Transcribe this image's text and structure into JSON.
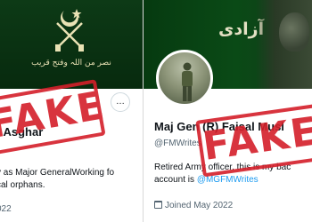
{
  "left_profile": {
    "banner_caption": "نصر من اللہ وفتح قریب",
    "more_button": "…",
    "name": ") Asghar",
    "bio_line1": "y as Major GeneralWorking fo",
    "bio_line2": "cal orphans.",
    "joined": "022",
    "stamp": "FAKE"
  },
  "right_profile": {
    "banner_title": "آزادی",
    "name": "Maj Gen (R) Faisal Musl",
    "handle": "@FMWrites",
    "bio_line1": "Retired Army officer. this is my bac",
    "bio_prefix": "account is ",
    "bio_mention": "@MGFMWrites",
    "joined": "Joined May 2022",
    "stamp": "FAKE"
  },
  "colors": {
    "stamp_red": "#d41f2a",
    "banner_green": "#0a4a16",
    "link_blue": "#1d9bf0"
  }
}
